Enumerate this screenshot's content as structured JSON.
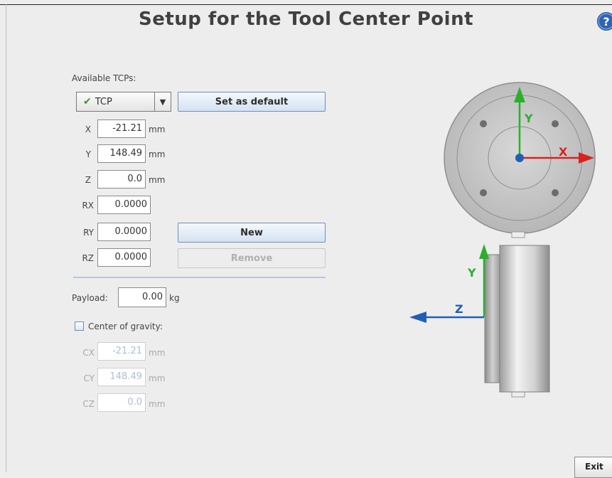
{
  "header": {
    "title": "Setup for the Tool Center Point",
    "help_icon": "?"
  },
  "tcp": {
    "available_label": "Available TCPs:",
    "selected": "TCP",
    "set_default_label": "Set as default",
    "new_label": "New",
    "remove_label": "Remove",
    "unit_mm": "mm",
    "coords": [
      {
        "axis": "X",
        "value": "-21.21",
        "unit": "mm"
      },
      {
        "axis": "Y",
        "value": "148.49",
        "unit": "mm"
      },
      {
        "axis": "Z",
        "value": "0.0",
        "unit": "mm"
      },
      {
        "axis": "RX",
        "value": "0.0000"
      },
      {
        "axis": "RY",
        "value": "0.0000"
      },
      {
        "axis": "RZ",
        "value": "0.0000"
      }
    ]
  },
  "payload": {
    "label": "Payload:",
    "value": "0.00",
    "unit": "kg"
  },
  "cog": {
    "checkbox_label": "Center of gravity:",
    "checked": false,
    "coords": [
      {
        "axis": "CX",
        "value": "-21.21",
        "unit": "mm"
      },
      {
        "axis": "CY",
        "value": "148.49",
        "unit": "mm"
      },
      {
        "axis": "CZ",
        "value": "0.0",
        "unit": "mm"
      }
    ]
  },
  "diagram": {
    "top_x_label": "X",
    "top_y_label": "Y",
    "side_y_label": "Y",
    "side_z_label": "Z",
    "colors": {
      "x_axis": "#d9231e",
      "y_axis": "#2bb02b",
      "z_axis": "#1f5fb5",
      "origin": "#1f5fb5"
    }
  },
  "footer": {
    "exit_label": "Exit"
  }
}
